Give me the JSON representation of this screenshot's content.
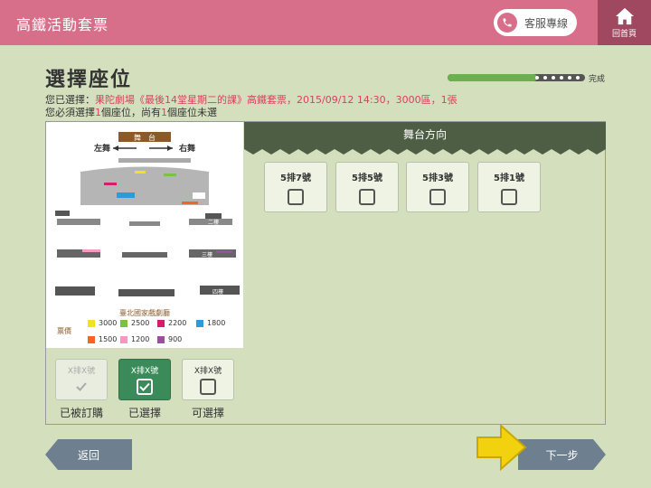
{
  "header": {
    "app_title": "高鐵活動套票",
    "customer_service_label": "客服專線",
    "home_label": "回首頁"
  },
  "page": {
    "title": "選擇座位",
    "progress": {
      "fraction": 0.65,
      "label": "完成"
    },
    "selection_prefix": "您已選擇：",
    "selection_detail": "果陀劇場《最後14堂星期二的課》高鐵套票，2015/09/12 14:30，3000區，1張",
    "instruction_prefix": "您必須選擇",
    "instruction_required": "1",
    "instruction_mid": "個座位，尚有",
    "instruction_remaining": "1",
    "instruction_suffix": "個座位未選"
  },
  "seat_map": {
    "stage_label": "舞　台",
    "left_dir": "左舞",
    "right_dir": "右舞",
    "floor2": "二樓",
    "floor3": "三樓",
    "floor4": "四樓",
    "venue": "臺北國家戲劇廳",
    "price_label": "票價",
    "prices": [
      {
        "label": "3000",
        "color": "#f3e21c"
      },
      {
        "label": "2500",
        "color": "#7cc242"
      },
      {
        "label": "2200",
        "color": "#d81b6e"
      },
      {
        "label": "1800",
        "color": "#2f9ad8"
      },
      {
        "label": "1500",
        "color": "#f26522"
      },
      {
        "label": "1200",
        "color": "#f49ac1"
      },
      {
        "label": "900",
        "color": "#9b4f9e"
      }
    ]
  },
  "stage_direction": "舞台方向",
  "seats": [
    {
      "label": "5排7號",
      "selected": false
    },
    {
      "label": "5排5號",
      "selected": false
    },
    {
      "label": "5排3號",
      "selected": false
    },
    {
      "label": "5排1號",
      "selected": false
    }
  ],
  "legend": {
    "booked": {
      "label": "X排X號",
      "caption": "已被訂購"
    },
    "selected": {
      "label": "X排X號",
      "caption": "已選擇"
    },
    "available": {
      "label": "X排X號",
      "caption": "可選擇"
    }
  },
  "nav": {
    "back_label": "返回",
    "next_label": "下一步"
  },
  "colors": {
    "header": "#d86f8a",
    "home": "#a0485f",
    "accent_green": "#3b8b5a",
    "nav": "#6e8090",
    "highlight": "#d8405e"
  }
}
